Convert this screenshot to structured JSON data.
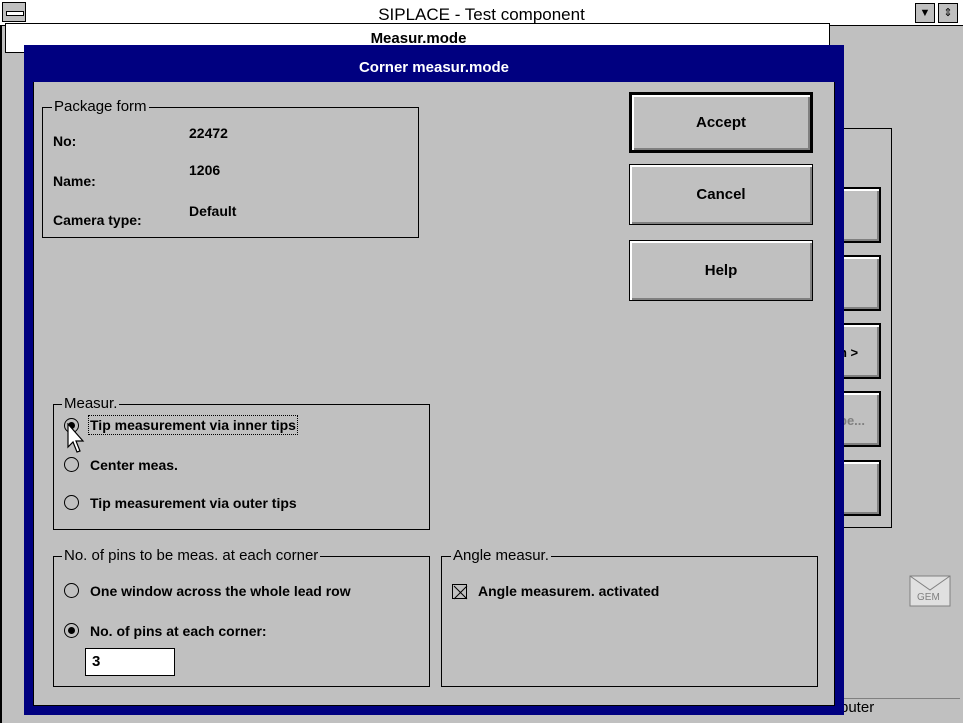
{
  "app": {
    "title": "SIPLACE - Test component"
  },
  "behind_window": {
    "title": "Measur.mode"
  },
  "background_buttons": [
    {
      "label": ""
    },
    {
      "label": ""
    },
    {
      "label": "n >"
    },
    {
      "label": "pe..."
    },
    {
      "label": ""
    }
  ],
  "status": {
    "text": "puter"
  },
  "mail_icon_label": "GEM",
  "dialog": {
    "title": "Corner measur.mode",
    "package_form": {
      "label": "Package form",
      "no_label": "No:",
      "no_value": "22472",
      "name_label": "Name:",
      "name_value": "1206",
      "camera_label": "Camera type:",
      "camera_value": "Default"
    },
    "buttons": {
      "accept": "Accept",
      "cancel": "Cancel",
      "help": "Help"
    },
    "measur": {
      "label": "Measur.",
      "options": [
        {
          "label": "Tip measurement via inner tips",
          "selected": true
        },
        {
          "label": "Center meas.",
          "selected": false
        },
        {
          "label": "Tip measurement via outer tips",
          "selected": false
        }
      ]
    },
    "pins": {
      "label": "No. of pins to be meas. at each corner",
      "options": [
        {
          "label": "One window across the whole lead row",
          "selected": false
        },
        {
          "label": "No. of pins at each corner:",
          "selected": true
        }
      ],
      "value": "3"
    },
    "angle": {
      "label": "Angle measur.",
      "checkbox_label": "Angle measurem. activated",
      "checked": true
    }
  }
}
